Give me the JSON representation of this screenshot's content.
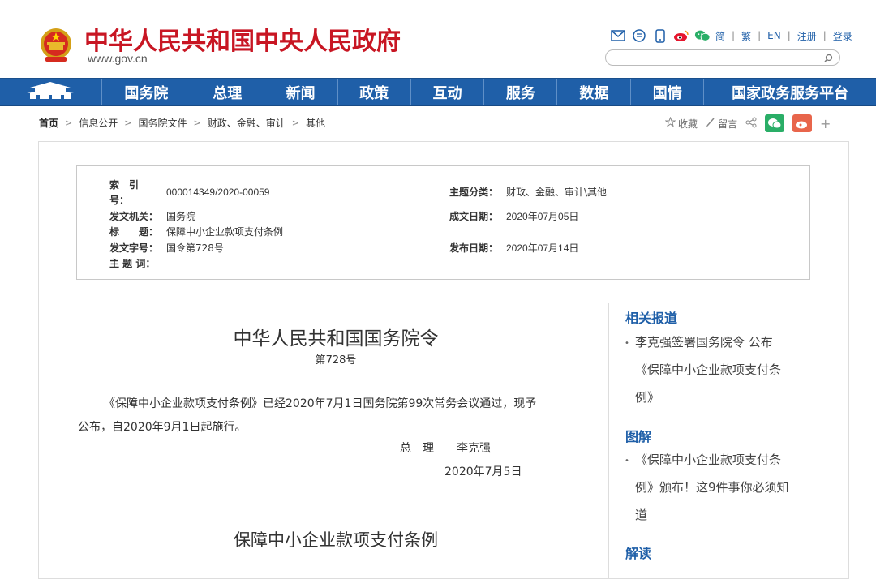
{
  "header": {
    "title": "中华人民共和国中央人民政府",
    "url": "www.gov.cn",
    "tools": {
      "icons": [
        "mail-icon",
        "rss-icon",
        "mobile-icon",
        "weibo-icon",
        "wechat-icon"
      ],
      "links": [
        "简",
        "繁",
        "EN",
        "注册",
        "登录"
      ]
    },
    "search": {
      "placeholder": ""
    }
  },
  "nav": {
    "items": [
      "国务院",
      "总理",
      "新闻",
      "政策",
      "互动",
      "服务",
      "数据",
      "国情",
      "国家政务服务平台"
    ],
    "color": "#1f5fa8"
  },
  "breadcrumb": [
    "首页",
    "信息公开",
    "国务院文件",
    "财政、金融、审计",
    "其他"
  ],
  "share": {
    "collect": "收藏",
    "comment": "留言",
    "plus": "+"
  },
  "meta": {
    "index_label": "索　引",
    "index_label2": "号：",
    "index": "000014349/2020-00059",
    "topic_label": "主题分类：",
    "topic": "财政、金融、审计\\其他",
    "issuer_label": "发文机关：",
    "issuer": "国务院",
    "date_label": "成文日期：",
    "date": "2020年07月05日",
    "title_label": "标　　题：",
    "title": "保障中小企业款项支付条例",
    "docno_label": "发文字号：",
    "docno": "国令第728号",
    "pub_label": "发布日期：",
    "pub": "2020年07月14日",
    "keywords_label": "主 题 词："
  },
  "article": {
    "title": "中华人民共和国国务院令",
    "number": "第728号",
    "para_line1": "《保障中小企业款项支付条例》已经2020年7月1日国务院第99次常务会议通过，现予",
    "para_line2": "公布，自2020年9月1日起施行。",
    "sign_role": "总　理　　李克强",
    "sign_date": "2020年7月5日",
    "subtitle": "保障中小企业款项支付条例"
  },
  "sidebar": {
    "related_heading": "相关报道",
    "related_line1": "李克强签署国务院令  公布",
    "related_line2": "《保障中小企业款项支付条",
    "related_line3": "例》",
    "graphic_heading": "图解",
    "graphic_line1": "《保障中小企业款项支付条",
    "graphic_line2": "例》颁布！这9件事你必须知",
    "graphic_line3": "道",
    "explain_heading": "解读"
  }
}
